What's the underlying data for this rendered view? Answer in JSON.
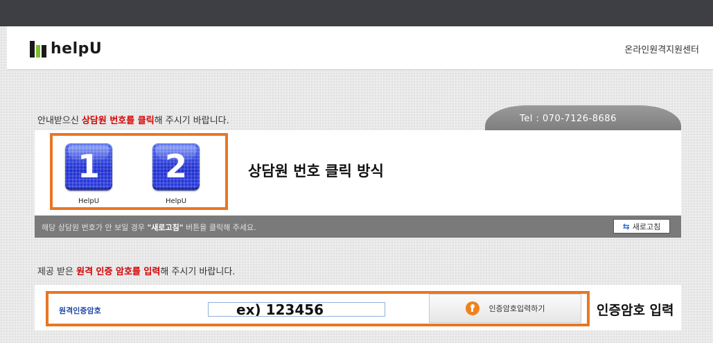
{
  "header": {
    "logo_text": "helpU",
    "center_name": "온라인원격지원센터"
  },
  "section1": {
    "guide_prefix": "안내받으신 ",
    "guide_highlight": "상담원 번호를 클릭",
    "guide_suffix": "해 주시기 바랍니다.",
    "tel": "Tel : 070-7126-8686",
    "buttons": [
      {
        "number": "1",
        "label": "HelpU"
      },
      {
        "number": "2",
        "label": "HelpU"
      }
    ],
    "method_annotation": "상담원 번호 클릭 방식",
    "refresh_prefix": "해당 상담원 번호가 안 보일 경우 ",
    "refresh_bold": "\"새로고침\"",
    "refresh_suffix": " 버튼을 클릭해 주세요.",
    "refresh_button": "새로고침",
    "refresh_icon": "refresh-arrows-icon"
  },
  "section2": {
    "guide_prefix": "제공 받은 ",
    "guide_highlight": "원격 인증 암호를 입력",
    "guide_suffix": "해 주시기 바랍니다.",
    "code_label": "원격인증암호",
    "code_placeholder": "ex) 123456",
    "auth_button": "인증암호입력하기",
    "auth_icon": "lock-icon",
    "method_annotation": "인증암호 입력"
  },
  "colors": {
    "highlight": "#d40000",
    "annotation_border": "#e87722",
    "button_blue": "#1f2fcf",
    "label_blue": "#1f4aa8"
  }
}
